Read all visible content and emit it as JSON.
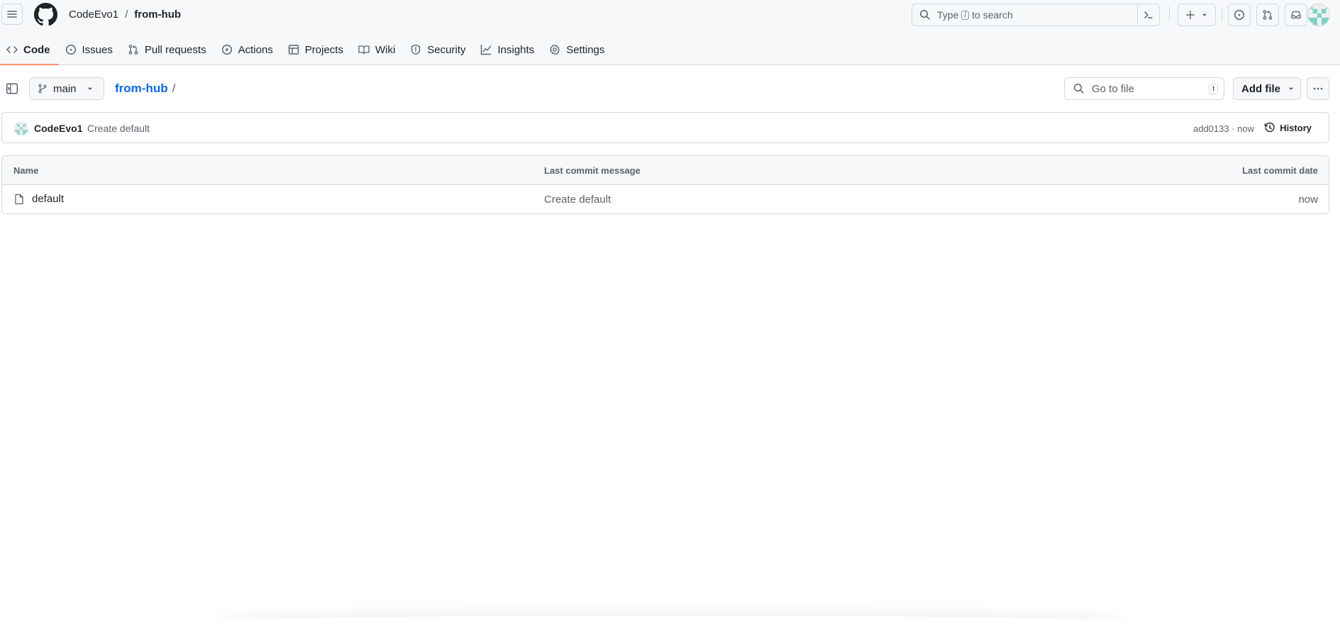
{
  "header": {
    "owner": "CodeEvo1",
    "separator": "/",
    "repo": "from-hub",
    "search": {
      "before": "Type",
      "key": "/",
      "after": "to search"
    }
  },
  "tabs": [
    {
      "label": "Code",
      "icon": "code-icon",
      "active": true
    },
    {
      "label": "Issues",
      "icon": "issue-icon"
    },
    {
      "label": "Pull requests",
      "icon": "pull-request-icon"
    },
    {
      "label": "Actions",
      "icon": "play-icon"
    },
    {
      "label": "Projects",
      "icon": "table-icon"
    },
    {
      "label": "Wiki",
      "icon": "book-icon"
    },
    {
      "label": "Security",
      "icon": "shield-icon"
    },
    {
      "label": "Insights",
      "icon": "graph-icon"
    },
    {
      "label": "Settings",
      "icon": "gear-icon"
    }
  ],
  "filebar": {
    "branch": "main",
    "path_repo": "from-hub",
    "path_slash": "/",
    "go_to_file": "Go to file",
    "go_to_file_key": "t",
    "add_file": "Add file"
  },
  "commit": {
    "author": "CodeEvo1",
    "message": "Create default",
    "meta": "add0133 · now",
    "history_label": "History"
  },
  "table": {
    "headers": {
      "name": "Name",
      "message": "Last commit message",
      "date": "Last commit date"
    },
    "rows": [
      {
        "name": "default",
        "message": "Create default",
        "date": "now"
      }
    ]
  }
}
